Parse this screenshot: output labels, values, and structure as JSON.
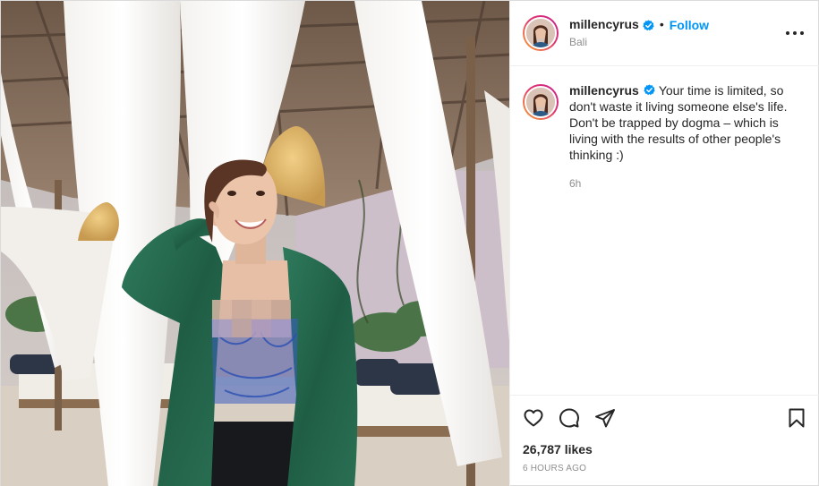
{
  "post": {
    "username": "millencyrus",
    "verified": true,
    "separator": "•",
    "follow_label": "Follow",
    "location": "Bali",
    "more_icon": "more-options-icon"
  },
  "caption": {
    "username": "millencyrus",
    "text": "Your time is limited, so don't waste it living someone else's life. Don't be trapped by dogma – which is living with the results of other people's thinking :)",
    "age": "6h"
  },
  "actions": {
    "icons": [
      "heart-icon",
      "comment-icon",
      "share-icon",
      "bookmark-icon"
    ],
    "likes": "26,787 likes",
    "time_ago": "6 HOURS AGO"
  },
  "colors": {
    "accent": "#0095f6",
    "text": "#262626",
    "muted": "#8e8e8e",
    "border": "#efefef"
  }
}
